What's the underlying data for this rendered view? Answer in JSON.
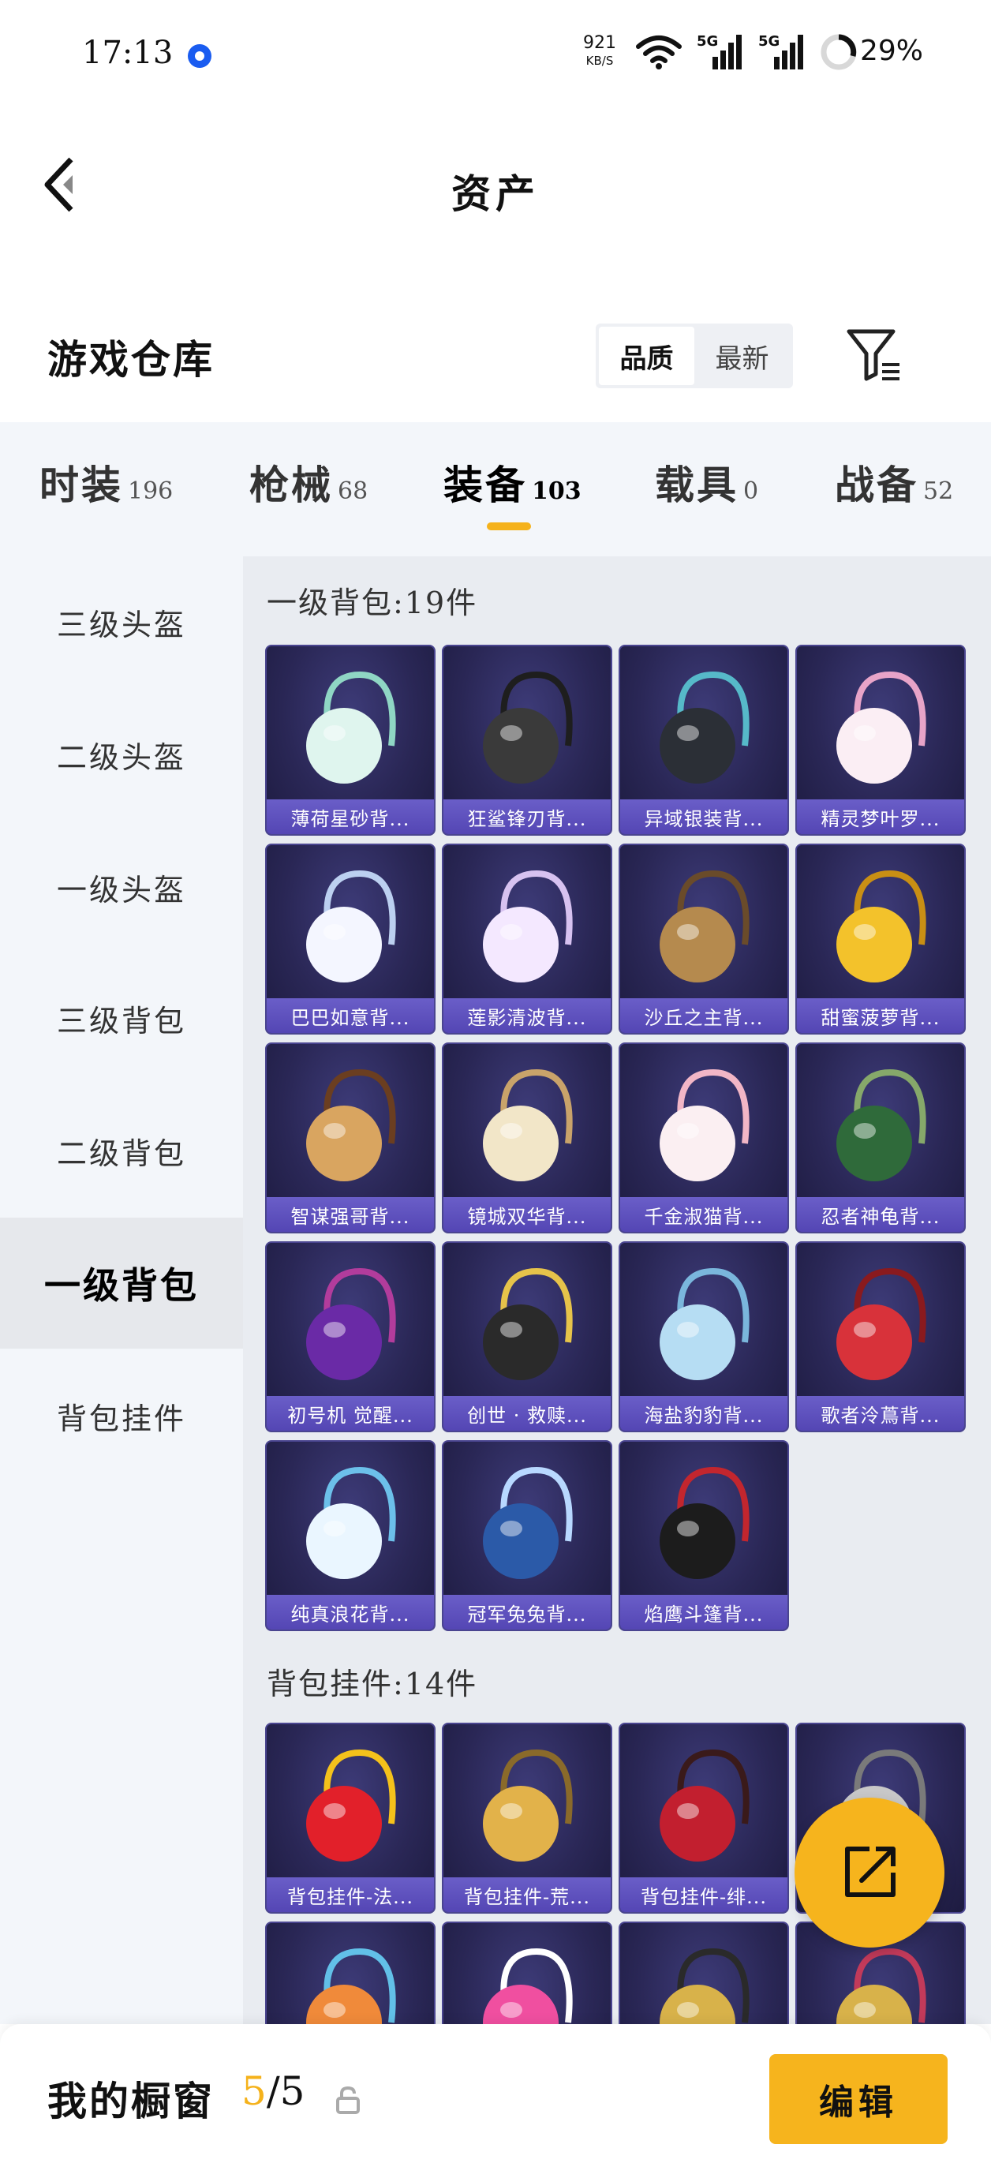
{
  "status_bar": {
    "time": "17:13",
    "net_speed": "921",
    "net_speed_unit": "KB/S",
    "network_1": "5G",
    "network_2": "5G",
    "battery": "29%"
  },
  "header": {
    "title": "资产"
  },
  "warehouse": {
    "title": "游戏仓库",
    "sort_options": [
      "品质",
      "最新"
    ],
    "active_sort": "品质"
  },
  "categories": [
    {
      "label": "时装",
      "count": "196"
    },
    {
      "label": "枪械",
      "count": "68"
    },
    {
      "label": "装备",
      "count": "103"
    },
    {
      "label": "载具",
      "count": "0"
    },
    {
      "label": "战备",
      "count": "52"
    }
  ],
  "active_category": "装备",
  "sidebar": {
    "items": [
      "三级头盔",
      "二级头盔",
      "一级头盔",
      "三级背包",
      "二级背包",
      "一级背包",
      "背包挂件"
    ],
    "active": "一级背包"
  },
  "sections": [
    {
      "title": "一级背包:19件",
      "items": [
        "薄荷星砂背...",
        "狂鲨锋刃背...",
        "异域银装背...",
        "精灵梦叶罗...",
        "巴巴如意背...",
        "莲影清波背...",
        "沙丘之主背...",
        "甜蜜菠萝背...",
        "智谋强哥背...",
        "镜城双华背...",
        "千金淑猫背...",
        "忍者神龟背...",
        "初号机 觉醒...",
        "创世 · 救赎...",
        "海盐豹豹背...",
        "歌者泠蔦背...",
        "纯真浪花背...",
        "冠军兔兔背...",
        "焰鹰斗篷背..."
      ]
    },
    {
      "title": "背包挂件:14件",
      "items": [
        "背包挂件-法...",
        "背包挂件-荒...",
        "背包挂件-绯...",
        "",
        "",
        "",
        "",
        ""
      ]
    }
  ],
  "bottom_bar": {
    "showcase_label": "我的橱窗",
    "showcase_current": "5",
    "showcase_total": "/5",
    "edit_label": "编辑"
  },
  "colors": {
    "accent": "#f6b41d",
    "card_bg": "#2a2756",
    "card_label": "#5e51bd"
  }
}
